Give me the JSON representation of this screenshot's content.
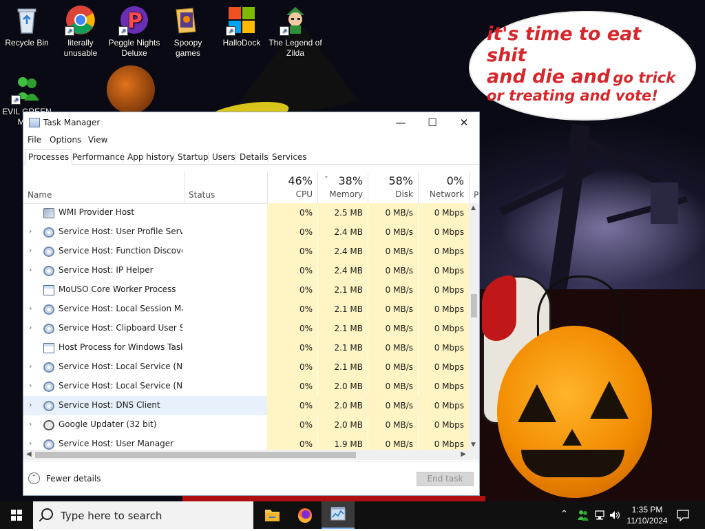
{
  "desktop": {
    "icons": [
      {
        "label": "Recycle Bin",
        "icon": "recycle-bin-icon"
      },
      {
        "label": "literally unusable",
        "icon": "chrome-icon"
      },
      {
        "label": "Peggle Nights Deluxe",
        "icon": "peggle-icon"
      },
      {
        "label": "Spoopy games",
        "icon": "folder-icon"
      },
      {
        "label": "HalloDock",
        "icon": "windows-logo-icon"
      },
      {
        "label": "The Legend of Zilda",
        "icon": "game-character-icon"
      },
      {
        "label": "EVIL GREEN MEN",
        "icon": "green-men-icon"
      }
    ],
    "speech_bubble": {
      "line1": "it's time to eat shit",
      "line2a": "and die and",
      "line2b": "go trick",
      "line3": "or treating and vote!"
    }
  },
  "task_manager": {
    "title": "Task Manager",
    "menu": [
      "File",
      "Options",
      "View"
    ],
    "tabs": [
      "Processes",
      "Performance",
      "App history",
      "Startup",
      "Users",
      "Details",
      "Services"
    ],
    "active_tab": "Processes",
    "columns": {
      "name": "Name",
      "status": "Status",
      "cpu": {
        "pct": "46%",
        "label": "CPU"
      },
      "memory": {
        "pct": "38%",
        "label": "Memory"
      },
      "disk": {
        "pct": "58%",
        "label": "Disk"
      },
      "network": {
        "pct": "0%",
        "label": "Network"
      },
      "next": "P"
    },
    "processes": [
      {
        "name": "WMI Provider Host",
        "expandable": false,
        "icon": "wmi",
        "cpu": "0%",
        "memory": "2.5 MB",
        "disk": "0 MB/s",
        "network": "0 Mbps"
      },
      {
        "name": "Service Host: User Profile Service",
        "expandable": true,
        "icon": "gear",
        "cpu": "0%",
        "memory": "2.4 MB",
        "disk": "0 MB/s",
        "network": "0 Mbps"
      },
      {
        "name": "Service Host: Function Discover...",
        "expandable": true,
        "icon": "gear",
        "cpu": "0%",
        "memory": "2.4 MB",
        "disk": "0 MB/s",
        "network": "0 Mbps"
      },
      {
        "name": "Service Host: IP Helper",
        "expandable": true,
        "icon": "gear",
        "cpu": "0%",
        "memory": "2.4 MB",
        "disk": "0 MB/s",
        "network": "0 Mbps"
      },
      {
        "name": "MoUSO Core Worker Process",
        "expandable": false,
        "icon": "app",
        "cpu": "0%",
        "memory": "2.1 MB",
        "disk": "0 MB/s",
        "network": "0 Mbps"
      },
      {
        "name": "Service Host: Local Session Man...",
        "expandable": true,
        "icon": "gear",
        "cpu": "0%",
        "memory": "2.1 MB",
        "disk": "0 MB/s",
        "network": "0 Mbps"
      },
      {
        "name": "Service Host: Clipboard User Ser...",
        "expandable": true,
        "icon": "gear",
        "cpu": "0%",
        "memory": "2.1 MB",
        "disk": "0 MB/s",
        "network": "0 Mbps"
      },
      {
        "name": "Host Process for Windows Tasks",
        "expandable": false,
        "icon": "app",
        "cpu": "0%",
        "memory": "2.1 MB",
        "disk": "0 MB/s",
        "network": "0 Mbps"
      },
      {
        "name": "Service Host: Local Service (Net...",
        "expandable": true,
        "icon": "gear",
        "cpu": "0%",
        "memory": "2.1 MB",
        "disk": "0 MB/s",
        "network": "0 Mbps"
      },
      {
        "name": "Service Host: Local Service (Net...",
        "expandable": true,
        "icon": "gear",
        "cpu": "0%",
        "memory": "2.0 MB",
        "disk": "0 MB/s",
        "network": "0 Mbps"
      },
      {
        "name": "Service Host: DNS Client",
        "expandable": true,
        "icon": "gear",
        "cpu": "0%",
        "memory": "2.0 MB",
        "disk": "0 MB/s",
        "network": "0 Mbps",
        "hover": true
      },
      {
        "name": "Google Updater (32 bit)",
        "expandable": true,
        "icon": "updater",
        "cpu": "0%",
        "memory": "2.0 MB",
        "disk": "0 MB/s",
        "network": "0 Mbps"
      },
      {
        "name": "Service Host: User Manager",
        "expandable": true,
        "icon": "gear",
        "cpu": "0%",
        "memory": "1.9 MB",
        "disk": "0 MB/s",
        "network": "0 Mbps"
      }
    ],
    "fewer_details": "Fewer details",
    "end_task": "End task"
  },
  "taskbar": {
    "search_placeholder": "Type here to search",
    "apps": [
      "file-explorer-icon",
      "firefox-icon",
      "task-manager-icon"
    ],
    "time": "1:35 PM",
    "date": "11/10/2024"
  },
  "colors": {
    "accent": "#0078d7",
    "usage_highlight": "#fff4c4",
    "bubble_text": "#d7262b"
  }
}
